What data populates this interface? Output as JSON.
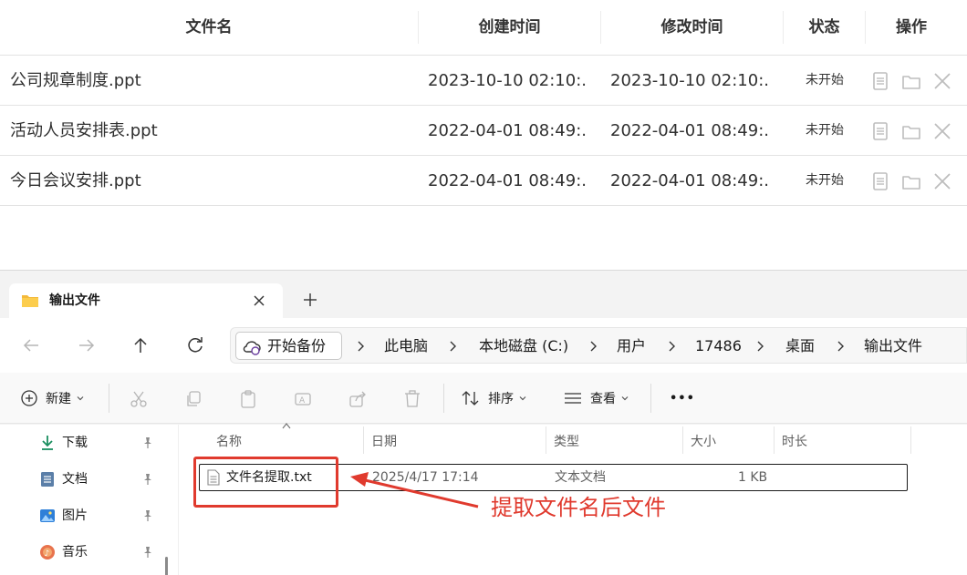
{
  "table": {
    "headers": {
      "name": "文件名",
      "created": "创建时间",
      "modified": "修改时间",
      "status": "状态",
      "ops": "操作"
    },
    "rows": [
      {
        "name": "公司规章制度.ppt",
        "created": "2023-10-10 02:10:...",
        "modified": "2023-10-10 02:10:...",
        "status": "未开始"
      },
      {
        "name": "活动人员安排表.ppt",
        "created": "2022-04-01 08:49:...",
        "modified": "2022-04-01 08:49:...",
        "status": "未开始"
      },
      {
        "name": "今日会议安排.ppt",
        "created": "2022-04-01 08:49:...",
        "modified": "2022-04-01 08:49:...",
        "status": "未开始"
      }
    ],
    "op_icons": [
      "document-icon",
      "folder-icon",
      "close-icon"
    ]
  },
  "explorer": {
    "tab": {
      "title": "输出文件"
    },
    "address": {
      "backup_label": "开始备份",
      "crumbs": [
        "此电脑",
        "本地磁盘 (C:)",
        "用户",
        "17486",
        "桌面",
        "输出文件"
      ]
    },
    "toolbar": {
      "new_label": "新建",
      "sort_label": "排序",
      "view_label": "查看",
      "more_label": "•••"
    },
    "sidebar": [
      {
        "label": "下载",
        "icon": "download-icon"
      },
      {
        "label": "文档",
        "icon": "documents-icon"
      },
      {
        "label": "图片",
        "icon": "pictures-icon"
      },
      {
        "label": "音乐",
        "icon": "music-icon"
      }
    ],
    "columns": {
      "name": "名称",
      "date": "日期",
      "type": "类型",
      "size": "大小",
      "duration": "时长"
    },
    "file": {
      "name": "文件名提取.txt",
      "date": "2025/4/17 17:14",
      "type": "文本文档",
      "size": "1 KB"
    }
  },
  "annotation": {
    "text": "提取文件名后文件",
    "color": "#e03a2e"
  }
}
